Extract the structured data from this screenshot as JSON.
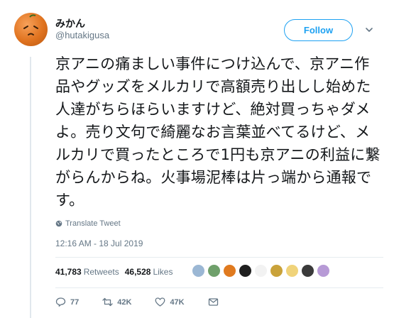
{
  "user": {
    "name": "みかん",
    "handle": "@hutakigusa"
  },
  "follow_label": "Follow",
  "tweet": {
    "text": "京アニの痛ましい事件につけ込んで、京アニ作品やグッズをメルカリで高額売り出しし始めた人達がちらほらいますけど、絶対買っちゃダメよ。売り文句で綺麗なお言葉並べてるけど、メルカリで買ったところで1円も京アニの利益に繋がらんからね。火事場泥棒は片っ端から通報です。",
    "translate_label": "Translate Tweet",
    "timestamp": "12:16 AM - 18 Jul 2019"
  },
  "stats": {
    "retweets_count": "41,783",
    "retweets_label": "Retweets",
    "likes_count": "46,528",
    "likes_label": "Likes"
  },
  "liker_avatars": [
    "#9bb7d4",
    "#6fa06b",
    "#e07a1f",
    "#1f1f1f",
    "#f2f2f2",
    "#c9a23a",
    "#f0d37a",
    "#3a3a3a",
    "#b79ad6"
  ],
  "actions": {
    "reply_count": "77",
    "retweet_count": "42K",
    "like_count": "47K"
  },
  "colors": {
    "accent": "#1da1f2",
    "secondary_text": "#657786"
  }
}
